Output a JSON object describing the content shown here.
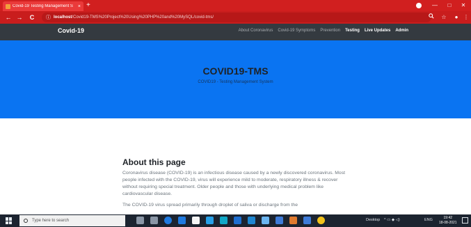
{
  "browser": {
    "tab_title": "Covid-19 Testing Management S",
    "tab_close": "×",
    "new_tab": "+",
    "url_host": "localhost",
    "url_path": "/Covid19-TMS%20Project%20Using%20PHP%20and%20MySQL/covid-tms/",
    "back": "←",
    "forward": "→",
    "reload": "C",
    "info": "ⓘ",
    "minimize": "—",
    "maximize": "□",
    "close": "✕"
  },
  "navbar": {
    "brand": "Covid-19",
    "links": [
      "About Coronavirus",
      "Covid-19 Symptoms",
      "Prevention",
      "Testing",
      "Live Updates",
      "Admin"
    ]
  },
  "hero": {
    "title": "COVID19-TMS",
    "subtitle": "COVID19 - Testing Management System"
  },
  "about": {
    "heading": "About this page",
    "paragraph1": "Coronavirus disease (COVID-19) is an infectious disease caused by a newly discovered coronavirus. Most people infected with the COVID-19, virus will experience mild to moderate, respiratory illness & recover without requiring special treatment. Older people and those with underlying medical problem like cardiovascular disease.",
    "paragraph2": "The COVID-19 virus spread primarily through droplet of saliva or discharge from the"
  },
  "taskbar": {
    "search_placeholder": "Type here to search",
    "desktop_label": "Desktop",
    "lang": "ENG",
    "time": "19:42",
    "date": "18-08-2021",
    "app_colors": [
      "#cfd6df",
      "#cfd6df",
      "#1f7ae0",
      "#1f7ae0",
      "#f4f4f4",
      "#27a0e8",
      "#10a8c8",
      "#1e6fd1",
      "#1e86d1",
      "#6bb5f0",
      "#e07a2e",
      "#3e7bd8",
      "#f2c21b"
    ]
  }
}
